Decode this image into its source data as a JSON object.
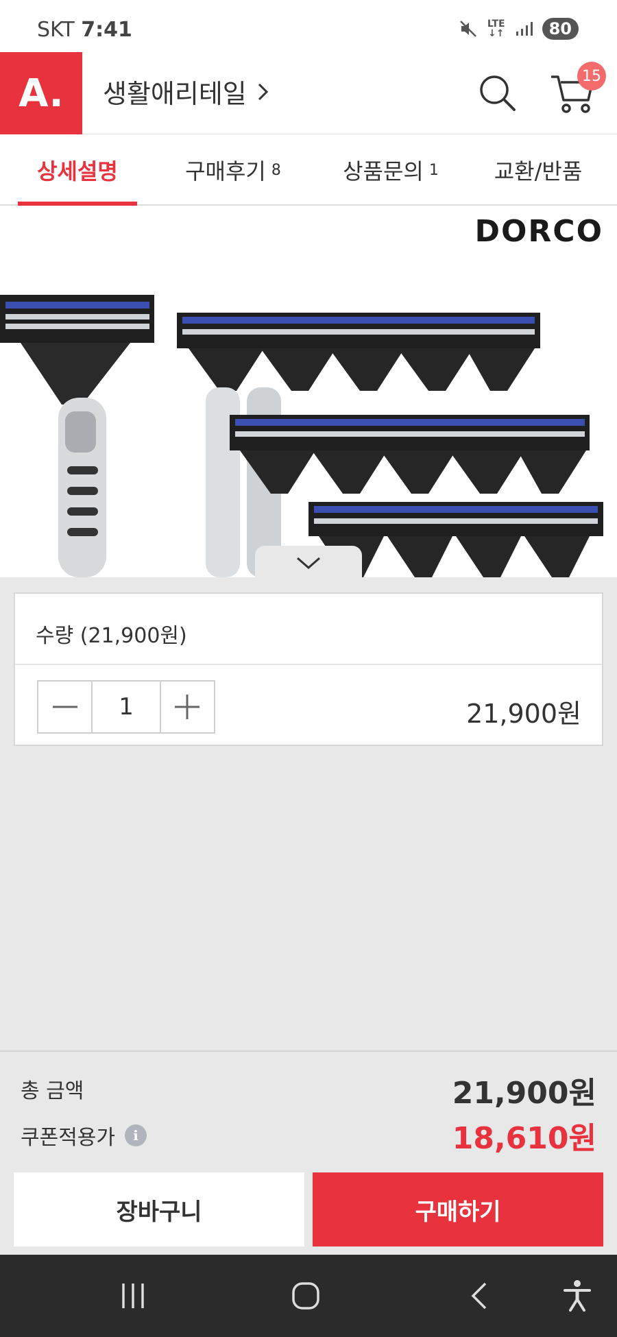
{
  "status_bar": {
    "carrier": "SKT",
    "time": "7:41",
    "network": "LTE",
    "battery": "80"
  },
  "header": {
    "logo": "A.",
    "category": "생활애리테일",
    "cart_count": "15"
  },
  "tabs": [
    {
      "label": "상세설명",
      "count": ""
    },
    {
      "label": "구매후기",
      "count": "8"
    },
    {
      "label": "상품문의",
      "count": "1"
    },
    {
      "label": "교환/반품",
      "count": ""
    }
  ],
  "product": {
    "brand": "DORCO"
  },
  "quantity_panel": {
    "title": "수량 (21,900원)",
    "quantity": "1",
    "price": "21,900원"
  },
  "summary": {
    "total_label": "총 금액",
    "total_value": "21,900원",
    "coupon_label": "쿠폰적용가",
    "coupon_value": "18,610원"
  },
  "actions": {
    "cart_label": "장바구니",
    "buy_label": "구매하기"
  },
  "colors": {
    "accent": "#e8323d",
    "badge": "#f46b6b",
    "info": "#b0b4bd"
  }
}
